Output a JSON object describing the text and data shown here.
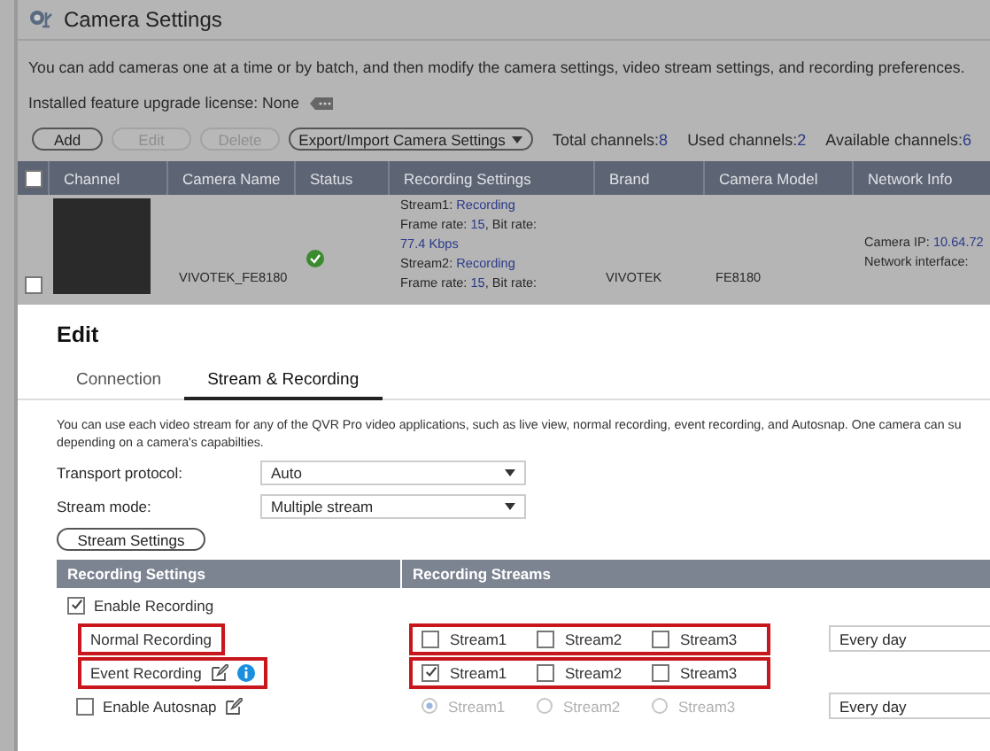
{
  "app": {
    "title": "Camera Settings",
    "description": "You can add cameras one at a time or by batch, and then modify the camera settings, video stream settings, and recording preferences.",
    "license": "Installed feature upgrade license: None",
    "buttons": [
      {
        "label": "Add",
        "disabled": false
      },
      {
        "label": "Edit",
        "disabled": true
      },
      {
        "label": "Delete",
        "disabled": true
      }
    ],
    "export_menu": "Export/Import Camera Settings",
    "counts": [
      {
        "label": "Total channels:",
        "value": "8"
      },
      {
        "label": "Used channels:",
        "value": "2"
      },
      {
        "label": "Available channels:",
        "value": "6"
      }
    ]
  },
  "table": {
    "columns": [
      "Channel",
      "Camera Name",
      "Status",
      "Recording Settings",
      "Brand",
      "Camera Model",
      "Network Info"
    ],
    "header_checked": false,
    "rows": [
      {
        "checked": false,
        "camera_name": "VIVOTEK_FE8180",
        "connected": true,
        "brand": "VIVOTEK",
        "model": "FE8180",
        "recording_settings": [
          [
            {
              "text": "Stream1: "
            },
            {
              "text": "Recording",
              "kind": "value"
            }
          ],
          [
            {
              "text": "Frame rate: "
            },
            {
              "text": "15",
              "kind": "value"
            },
            {
              "text": ", Bit rate:"
            }
          ],
          [
            {
              "text": "77.4 Kbps",
              "kind": "value"
            }
          ],
          [
            {
              "text": "Stream2: "
            },
            {
              "text": "Recording",
              "kind": "value"
            }
          ],
          [
            {
              "text": "Frame rate: "
            },
            {
              "text": "15",
              "kind": "value"
            },
            {
              "text": ", Bit rate:"
            }
          ]
        ],
        "network_info": [
          [
            {
              "text": "Camera IP: "
            },
            {
              "text": "10.64.72",
              "kind": "value"
            }
          ],
          [
            {
              "text": "Network interface:"
            }
          ]
        ]
      }
    ]
  },
  "dialog": {
    "title": "Edit",
    "tabs": [
      {
        "label": "Connection",
        "selected": false
      },
      {
        "label": "Stream & Recording",
        "selected": true
      }
    ],
    "description_lines": [
      "You can use each video stream for any of the QVR Pro video applications, such as live view, normal recording, event recording, and Autosnap. One camera can su",
      "depending on a camera's capabilties."
    ],
    "fields": [
      {
        "label": "Transport protocol:",
        "value": "Auto"
      },
      {
        "label": "Stream mode:",
        "value": "Multiple stream"
      }
    ],
    "stream_settings_button": "Stream Settings",
    "recording": {
      "columns": [
        "Recording Settings",
        "Recording Streams"
      ],
      "rows": [
        {
          "kind": "toggle",
          "label": "Enable Recording",
          "checked": true
        },
        {
          "kind": "checkboxes",
          "label": "Normal Recording",
          "highlighted": true,
          "streams": [
            {
              "label": "Stream1",
              "checked": false
            },
            {
              "label": "Stream2",
              "checked": false
            },
            {
              "label": "Stream3",
              "checked": false
            }
          ],
          "schedule": "Every day"
        },
        {
          "kind": "checkboxes",
          "label": "Event Recording",
          "highlighted": true,
          "edit_icon": true,
          "info_icon": true,
          "streams": [
            {
              "label": "Stream1",
              "checked": true
            },
            {
              "label": "Stream2",
              "checked": false
            },
            {
              "label": "Stream3",
              "checked": false
            }
          ]
        },
        {
          "kind": "radios",
          "label": "Enable Autosnap",
          "checked": false,
          "edit_icon": true,
          "disabled": true,
          "streams": [
            {
              "label": "Stream1",
              "selected": true
            },
            {
              "label": "Stream2",
              "selected": false
            },
            {
              "label": "Stream3",
              "selected": false
            }
          ],
          "schedule": "Every day"
        }
      ]
    }
  }
}
